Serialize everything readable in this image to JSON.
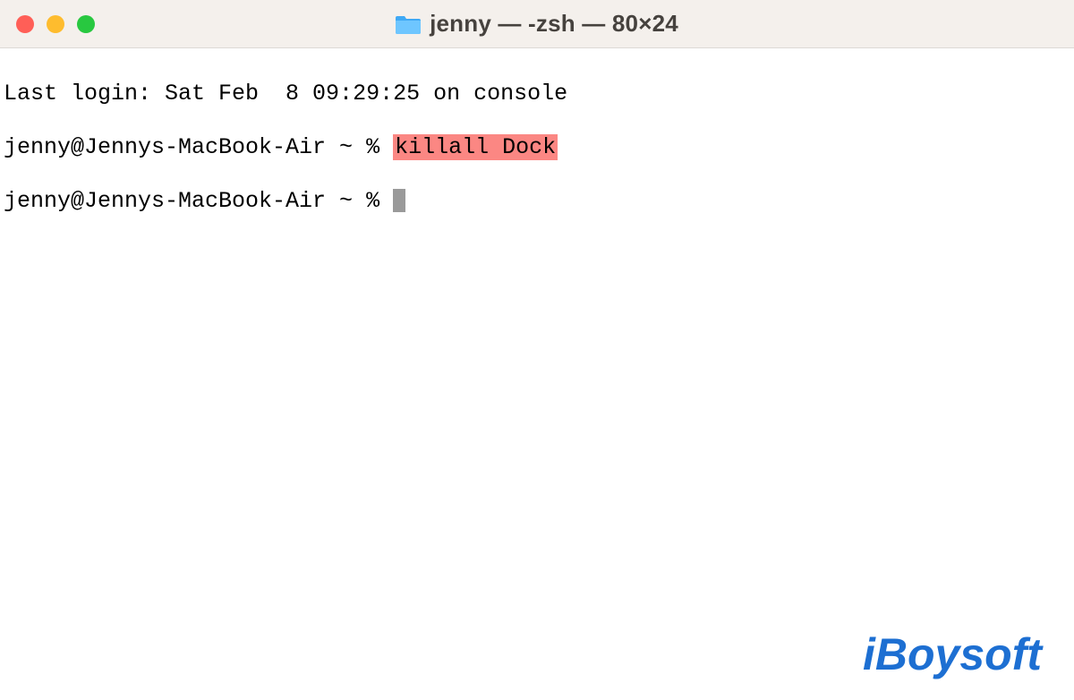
{
  "window": {
    "title": "jenny — -zsh — 80×24",
    "icon": "folder-icon"
  },
  "terminal": {
    "last_login": "Last login: Sat Feb  8 09:29:25 on console",
    "prompt1": "jenny@Jennys-MacBook-Air ~ % ",
    "command1": "killall Dock",
    "prompt2": "jenny@Jennys-MacBook-Air ~ % "
  },
  "watermark": {
    "text": "iBoysoft"
  },
  "colors": {
    "highlight": "#fb8783",
    "brand": "#1d6fd2"
  }
}
